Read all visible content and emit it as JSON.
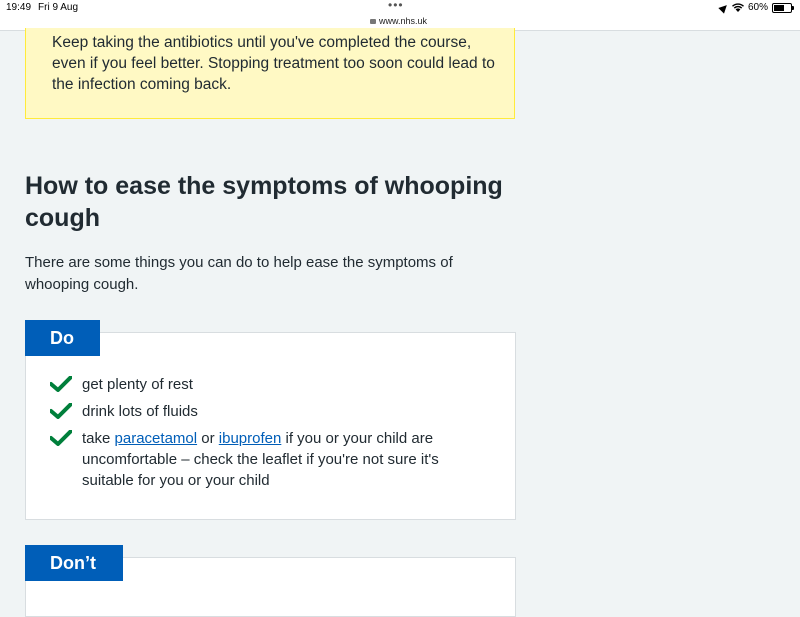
{
  "status_bar": {
    "time": "19:49",
    "date": "Fri 9 Aug",
    "url": "www.nhs.uk",
    "battery": "60%",
    "battery_level": 0.6
  },
  "warning": {
    "text": "Keep taking the antibiotics until you've completed the course, even if you feel better. Stopping treatment too soon could lead to the infection coming back."
  },
  "section": {
    "title": "How to ease the symptoms of whooping cough",
    "intro": "There are some things you can do to help ease the symptoms of whooping cough."
  },
  "do": {
    "label": "Do",
    "items": [
      "get plenty of rest",
      "drink lots of fluids"
    ],
    "item3": {
      "prefix": "take ",
      "link1": "paracetamol",
      "mid": " or ",
      "link2": "ibuprofen",
      "suffix": " if you or your child are uncomfortable – check the leaflet if you're not sure it's suitable for you or your child"
    }
  },
  "dont": {
    "label": "Don’t"
  },
  "colors": {
    "nhs_blue": "#005eb8",
    "tick_green": "#007f3b",
    "warning_bg": "#fff9c4"
  }
}
